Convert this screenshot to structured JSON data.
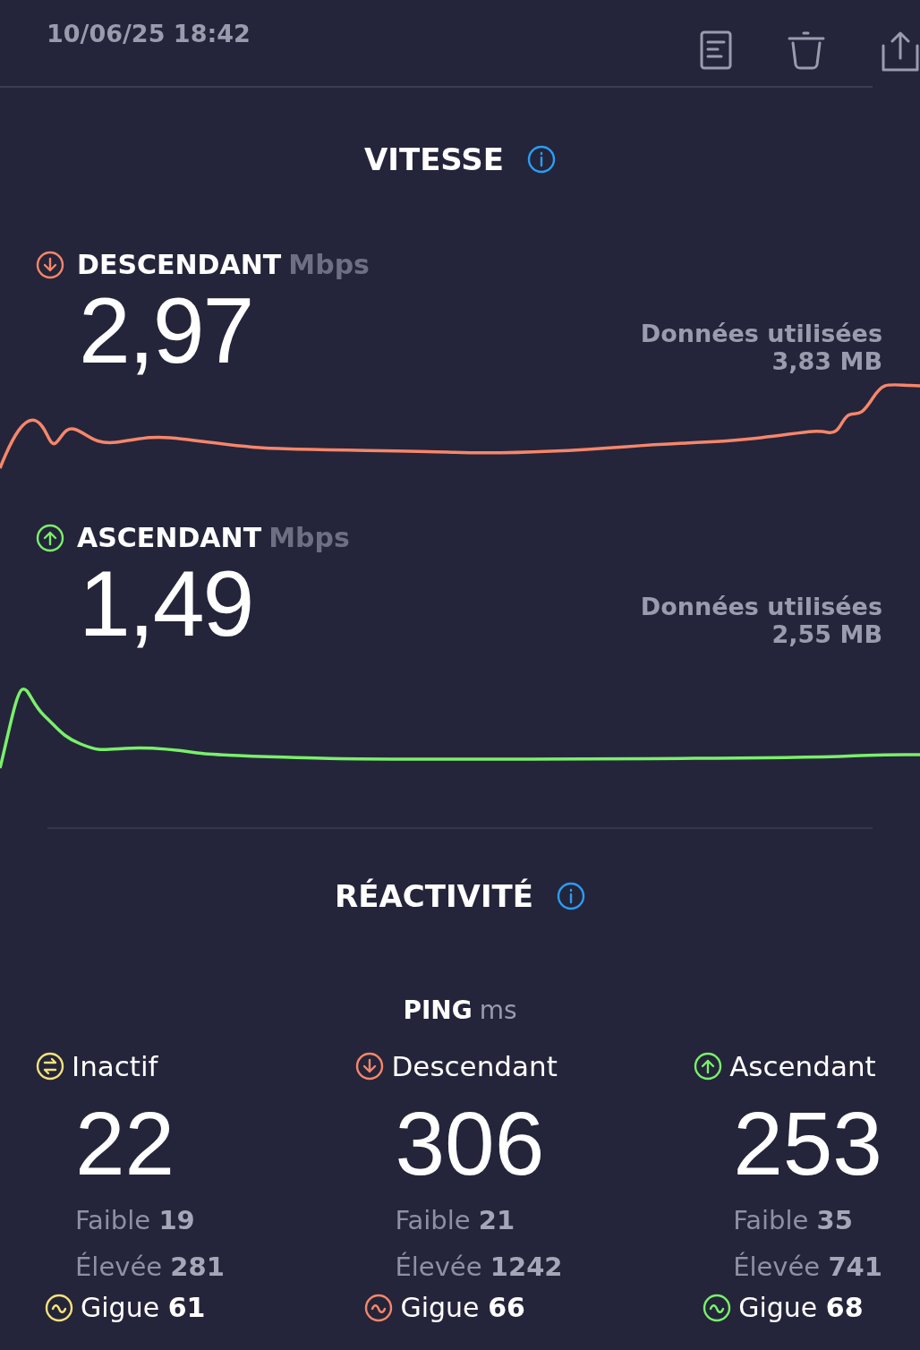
{
  "timestamp": "10/06/25 18:42",
  "speed": {
    "title": "VITESSE",
    "metrics": [
      {
        "kind": "download",
        "label": "DESCENDANT",
        "unit": "Mbps",
        "value": "2,97",
        "data_label": "Données utilisées",
        "data_value": "3,83 MB",
        "color": "#f7866a"
      },
      {
        "kind": "upload",
        "label": "ASCENDANT",
        "unit": "Mbps",
        "value": "1,49",
        "data_label": "Données utilisées",
        "data_value": "2,55 MB",
        "color": "#7af06a"
      }
    ]
  },
  "responsiveness": {
    "title": "RÉACTIVITÉ",
    "ping_label": "PING",
    "ping_unit": "ms",
    "columns": [
      {
        "kind": "idle",
        "label": "Inactif",
        "value": "22",
        "low": "Faible **19**",
        "high": "Élevée **281**",
        "jitter": "Gigue **61**",
        "color": "#f4e27a"
      },
      {
        "kind": "download",
        "label": "Descendant",
        "value": "306",
        "low": "Faible **21**",
        "high": "Élevée **1242**",
        "jitter": "Gigue **66**",
        "color": "#f7866a"
      },
      {
        "kind": "upload",
        "label": "Ascendant",
        "value": "253",
        "low": "Faible **35**",
        "high": "Élevée **741**",
        "jitter": "Gigue **68**",
        "color": "#7af06a"
      }
    ]
  }
}
